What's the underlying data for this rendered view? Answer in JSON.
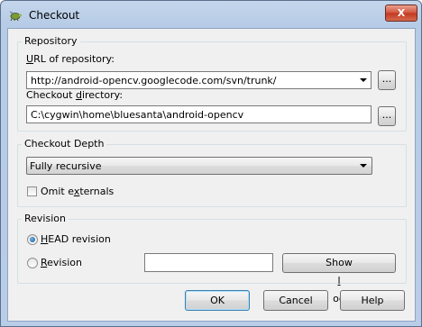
{
  "window": {
    "title": "Checkout",
    "close_glyph": "X"
  },
  "repository": {
    "group_label": "Repository",
    "url_label": "URL of repository:",
    "url_value": "http://android-opencv.googlecode.com/svn/trunk/",
    "browse_url_label": "...",
    "dir_label": "Checkout directory:",
    "dir_value": "C:\\cygwin\\home\\bluesanta\\android-opencv",
    "browse_dir_label": "..."
  },
  "depth": {
    "group_label": "Checkout Depth",
    "selected": "Fully recursive",
    "omit_externals_label": "Omit externals",
    "omit_externals_checked": false
  },
  "revision": {
    "group_label": "Revision",
    "head_label": "HEAD revision",
    "head_selected": true,
    "revision_label": "Revision",
    "revision_value": "",
    "show_log_label": "Show log"
  },
  "buttons": {
    "ok": "OK",
    "cancel": "Cancel",
    "help": "Help"
  },
  "icons": {
    "app": "tortoise-icon",
    "close": "close-icon",
    "dropdown": "chevron-down-icon"
  }
}
